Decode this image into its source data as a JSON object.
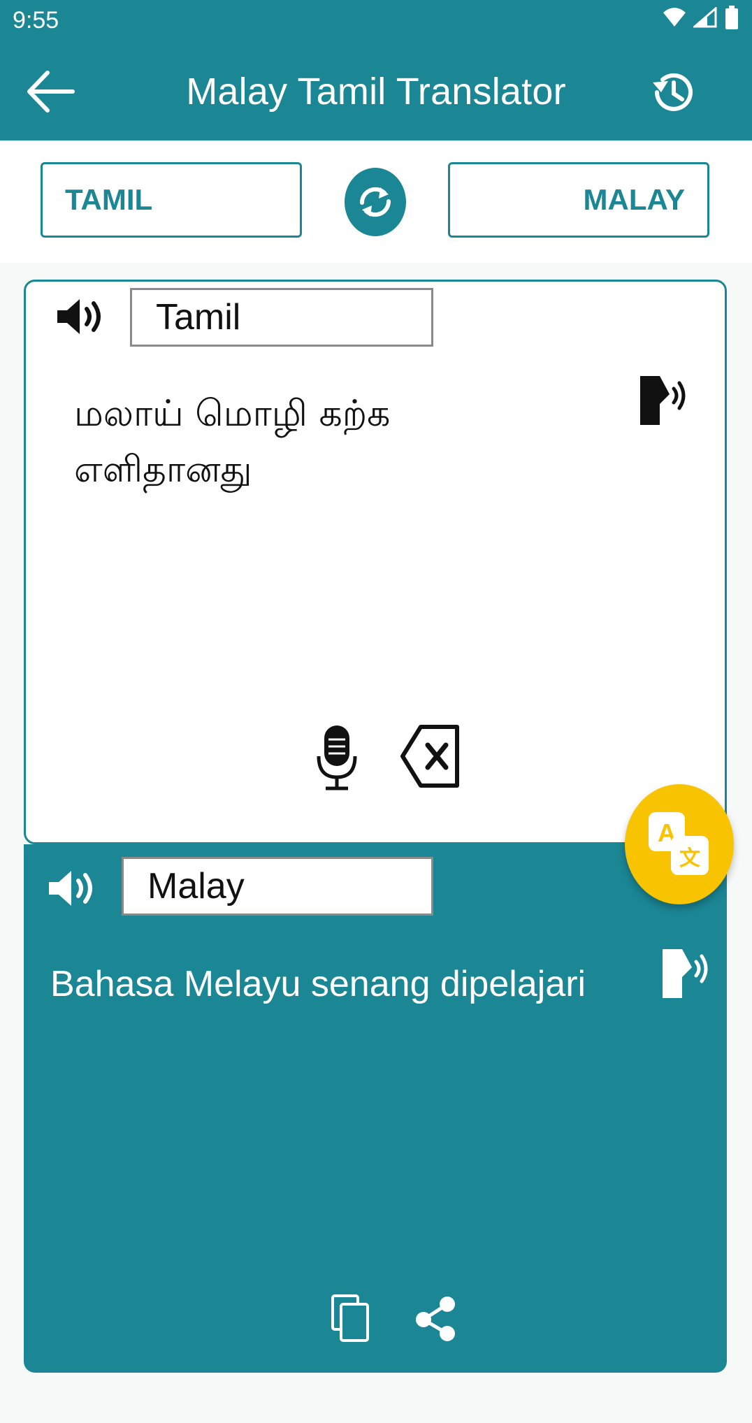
{
  "status_bar": {
    "time": "9:55"
  },
  "app_bar": {
    "title": "Malay Tamil Translator"
  },
  "language_selector": {
    "source": "TAMIL",
    "target": "MALAY"
  },
  "source_panel": {
    "language_label": "Tamil",
    "text": "மலாய் மொழி கற்க எளிதானது"
  },
  "target_panel": {
    "language_label": "Malay",
    "text": "Bahasa Melayu senang dipelajari"
  },
  "colors": {
    "primary": "#1b8694",
    "fab": "#f8c300",
    "background": "#f7f8f8"
  },
  "icons": {
    "back": "arrow-left-icon",
    "history": "history-icon",
    "swap": "swap-icon",
    "speaker": "speaker-icon",
    "tts": "tts-icon",
    "mic": "mic-icon",
    "clear": "backspace-icon",
    "translate": "translate-icon",
    "copy": "copy-icon",
    "share": "share-icon"
  }
}
